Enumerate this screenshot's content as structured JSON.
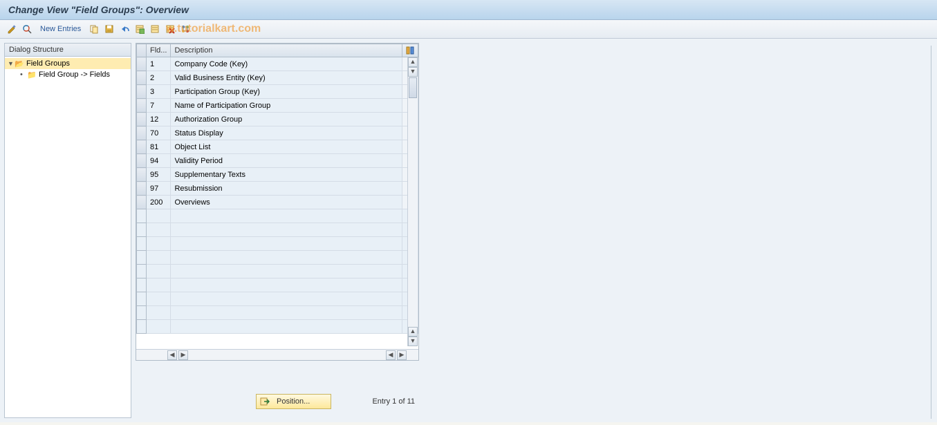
{
  "title": "Change View \"Field Groups\": Overview",
  "watermark": "w.tutorialkart.com",
  "toolbar": {
    "new_entries_label": "New Entries"
  },
  "dialog": {
    "header": "Dialog Structure",
    "root": {
      "label": "Field Groups",
      "child": {
        "label": "Field Group -> Fields"
      }
    }
  },
  "table": {
    "columns": {
      "fld": "Fld...",
      "desc": "Description"
    },
    "rows": [
      {
        "fld": "1",
        "desc": "Company Code (Key)"
      },
      {
        "fld": "2",
        "desc": "Valid Business Entity (Key)"
      },
      {
        "fld": "3",
        "desc": "Participation Group (Key)"
      },
      {
        "fld": "7",
        "desc": "Name of Participation Group"
      },
      {
        "fld": "12",
        "desc": "Authorization Group"
      },
      {
        "fld": "70",
        "desc": "Status Display"
      },
      {
        "fld": "81",
        "desc": "Object List"
      },
      {
        "fld": "94",
        "desc": "Validity Period"
      },
      {
        "fld": "95",
        "desc": "Supplementary Texts"
      },
      {
        "fld": "97",
        "desc": "Resubmission"
      },
      {
        "fld": "200",
        "desc": "Overviews"
      }
    ],
    "empty_rows": 9
  },
  "footer": {
    "position_label": "Position...",
    "entry_text": "Entry 1 of 11"
  }
}
